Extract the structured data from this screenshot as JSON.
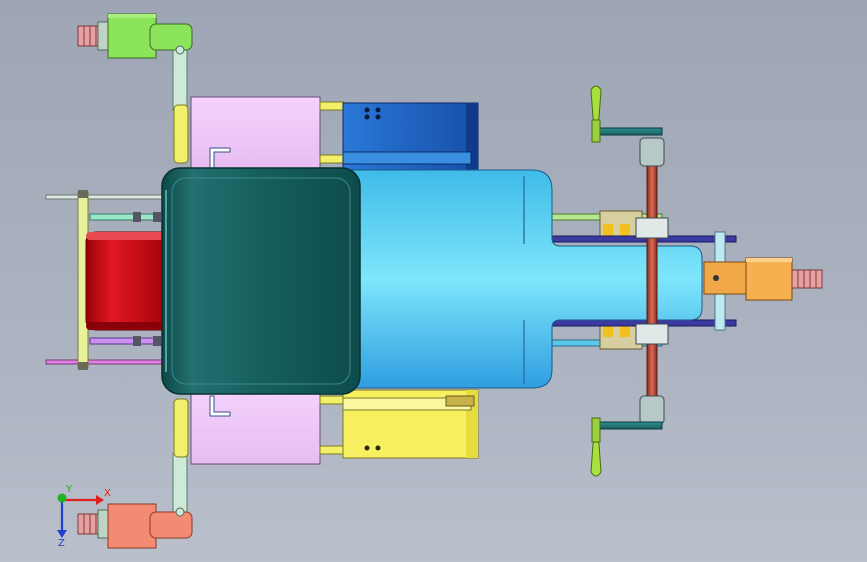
{
  "viewport": {
    "background_top": "#9ea6b5",
    "background_bottom": "#b9bfcb"
  },
  "triad": {
    "x_label": "X",
    "y_label": "Y",
    "z_label": "Z",
    "x_color": "#e02020",
    "y_color": "#20b020",
    "z_color": "#2040d0"
  },
  "parts": {
    "cab_color": "#155c5c",
    "body_color": "#42c8f2",
    "mount_color": "#f0c8f8",
    "red_block_color": "#c80a14",
    "blue_box_color": "#1c64c8",
    "yellow_box_color": "#f8f060",
    "green_bracket_color": "#88e050",
    "salmon_bracket_color": "#f08870",
    "orange_bracket_color": "#f0a848"
  }
}
